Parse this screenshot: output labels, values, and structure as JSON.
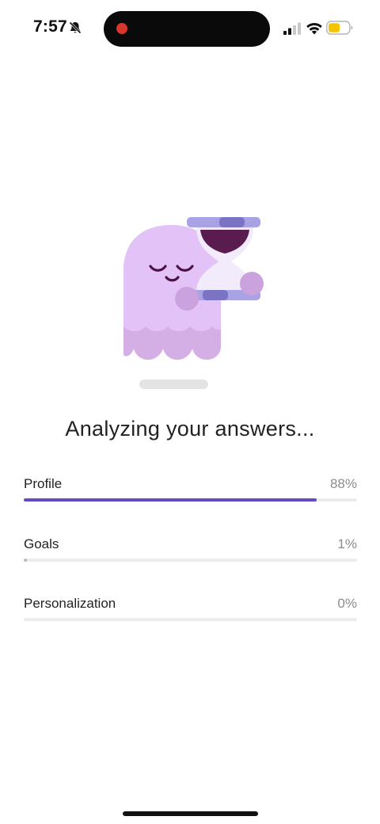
{
  "status_bar": {
    "time": "7:57",
    "icons": [
      "bell-off-icon",
      "record-dot-icon",
      "signal-icon",
      "wifi-icon",
      "battery-icon"
    ],
    "battery_color": "#f5c400"
  },
  "illustration": {
    "name": "ghost-with-hourglass",
    "colors": {
      "ghost": "#e3c3f7",
      "ghost_shadow": "#d3afe6",
      "hourglass_frame": "#a9a3e6",
      "hourglass_frame_dark": "#7b73c4",
      "sand": "#5a1c4f",
      "ground_shadow": "#e4e4e4"
    }
  },
  "title": "Analyzing your answers...",
  "progress": [
    {
      "label": "Profile",
      "value_text": "88%",
      "fraction": 0.88
    },
    {
      "label": "Goals",
      "value_text": "1%",
      "fraction": 0.01
    },
    {
      "label": "Personalization",
      "value_text": "0%",
      "fraction": 0.0
    }
  ],
  "colors": {
    "accent": "#6548c8",
    "track": "#ececec"
  }
}
